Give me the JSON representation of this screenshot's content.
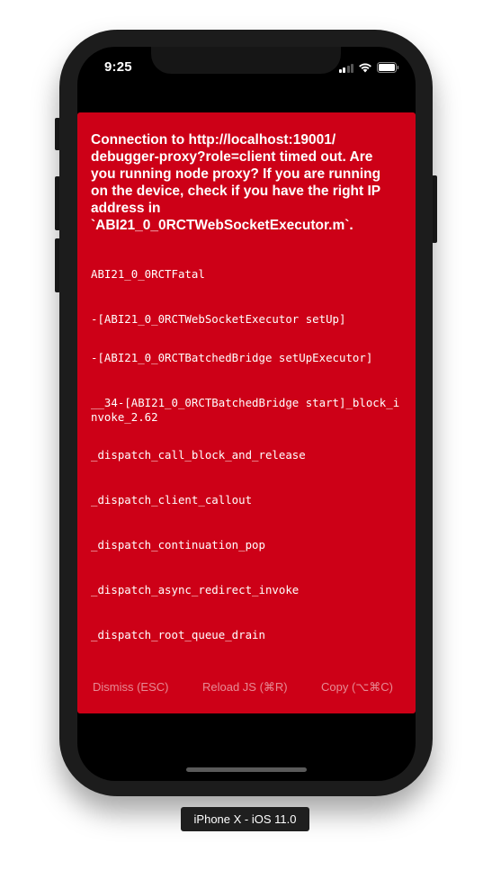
{
  "status_bar": {
    "time": "9:25",
    "icons": [
      "signal-icon",
      "wifi-icon",
      "battery-icon"
    ]
  },
  "redbox": {
    "background_color": "#cd0017",
    "message": "Connection to http://localhost:19001/\ndebugger-proxy?role=client timed out. Are\nyou running node proxy? If you are running\non the device, check if you have the right IP\naddress in\n`ABI21_0_0RCTWebSocketExecutor.m`.",
    "stack": [
      "ABI21_0_0RCTFatal",
      "-[ABI21_0_0RCTWebSocketExecutor setUp]",
      "-[ABI21_0_0RCTBatchedBridge setUpExecutor]",
      "__34-[ABI21_0_0RCTBatchedBridge start]_block_invoke_2.62",
      "_dispatch_call_block_and_release",
      "_dispatch_client_callout",
      "_dispatch_continuation_pop",
      "_dispatch_async_redirect_invoke",
      "_dispatch_root_queue_drain"
    ],
    "buttons": {
      "dismiss": "Dismiss (ESC)",
      "reload": "Reload JS (⌘R)",
      "copy": "Copy (⌥⌘C)"
    }
  },
  "device_label": "iPhone X - iOS 11.0"
}
